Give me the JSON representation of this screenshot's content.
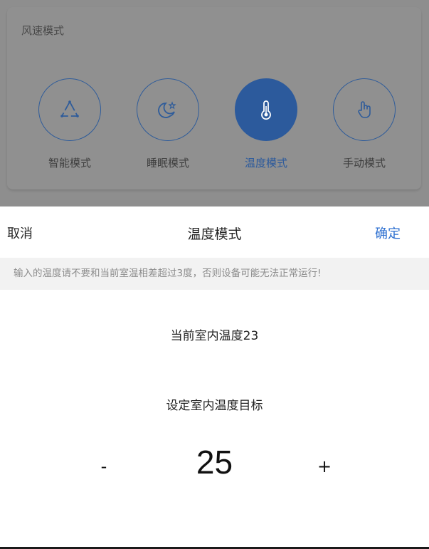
{
  "fan_speed_card": {
    "title": "风速模式",
    "modes": [
      {
        "label": "智能模式",
        "icon": "smart-triangle-icon",
        "active": false
      },
      {
        "label": "睡眠模式",
        "icon": "moon-star-icon",
        "active": false
      },
      {
        "label": "温度模式",
        "icon": "thermometer-icon",
        "active": true
      },
      {
        "label": "手动模式",
        "icon": "hand-pointer-icon",
        "active": false
      }
    ]
  },
  "sheet": {
    "cancel_label": "取消",
    "title": "温度模式",
    "confirm_label": "确定",
    "warning": "输入的温度请不要和当前室温相差超过3度，否则设备可能无法正常运行!",
    "current_temp_label": "当前室内温度23",
    "target_label": "设定室内温度目标",
    "stepper": {
      "minus_label": "-",
      "value": "25",
      "plus_label": "+"
    }
  },
  "colors": {
    "accent": "#2c6fd0",
    "active_mode": "#2c5a9c",
    "overlay": "#8e8e8e"
  }
}
